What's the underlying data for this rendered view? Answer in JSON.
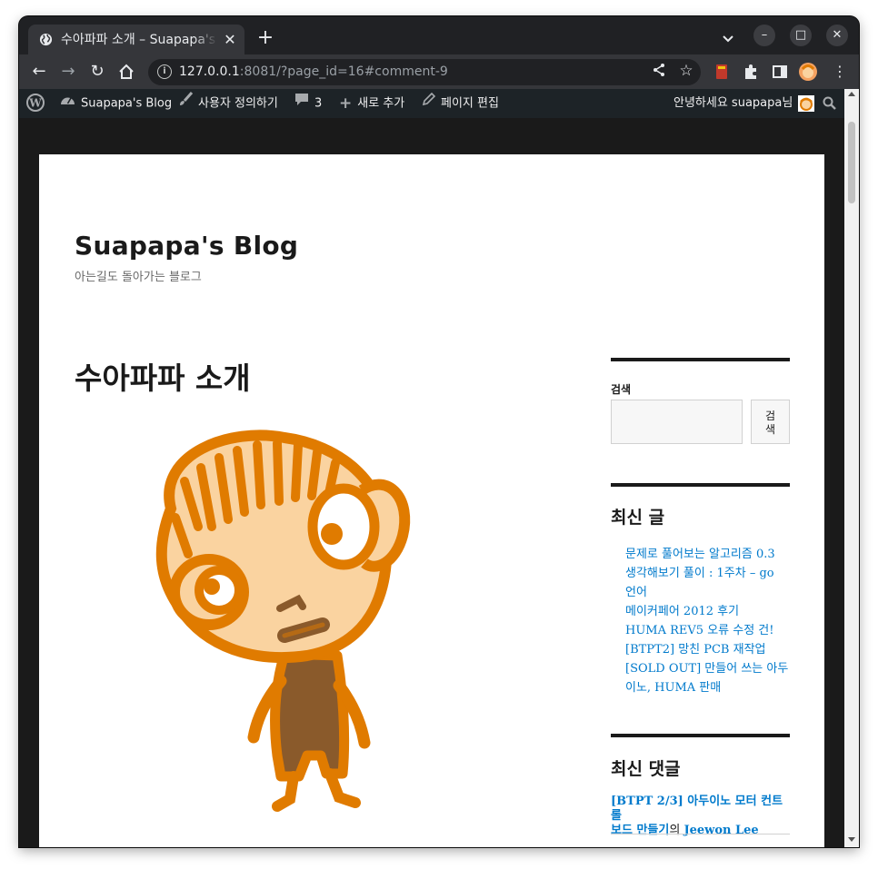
{
  "browser": {
    "tab_title": "수아파파 소개 – Suapapa's Blog",
    "tab_close": "✕",
    "new_tab": "+",
    "url_host": "127.0.0.1",
    "url_rest": ":8081/?page_id=16#comment-9",
    "window_minimize": "–",
    "window_maximize": "□",
    "window_close": "✕"
  },
  "adminbar": {
    "site_name": "Suapapa's Blog",
    "customize": "사용자 정의하기",
    "comments_count": "3",
    "new_content": "새로 추가",
    "edit_page": "페이지 편집",
    "greeting": "안녕하세요 suapapa님"
  },
  "site": {
    "title": "Suapapa's Blog",
    "description": "아는길도 돌아가는 블로그"
  },
  "page": {
    "title": "수아파파 소개"
  },
  "sidebar": {
    "search_label": "검색",
    "search_button_line1": "검",
    "search_button_line2": "색",
    "recent_posts_title": "최신 글",
    "recent_posts": [
      "문제로 풀어보는 알고리즘 0.3",
      "생각해보기 풀이 : 1주차 – go",
      "언어",
      "메이커페어 2012 후기",
      "HUMA REV5 오류 수정 건!",
      "[BTPT2] 망친 PCB 재작업",
      "[SOLD OUT] 만들어 쓰는 아두",
      "이노, HUMA 판매"
    ],
    "recent_comments_title": "최신 댓글",
    "comment_post_line1": "[BTPT 2/3] 아두이노 모터 컨트롤",
    "comment_post_line2": "보드 만들기",
    "comment_connector": "의",
    "comment_author": "Jeewon Lee"
  },
  "colors": {
    "link": "#007acc",
    "adminbar_bg": "#1d2327",
    "orange": "#e07b00",
    "skin": "#fad3a0",
    "brown": "#8a5a2b"
  }
}
